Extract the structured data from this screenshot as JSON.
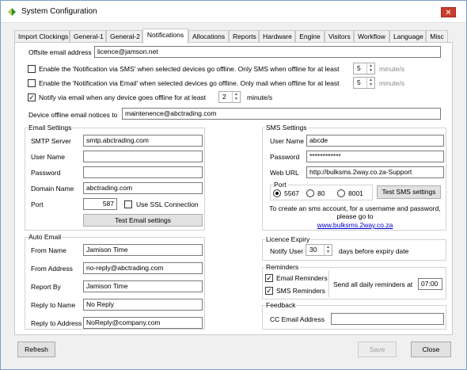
{
  "window": {
    "title": "System Configuration",
    "close_glyph": "✕"
  },
  "tabs": [
    {
      "label": "Import Clockings"
    },
    {
      "label": "General-1"
    },
    {
      "label": "General-2"
    },
    {
      "label": "Notifications"
    },
    {
      "label": "Allocations"
    },
    {
      "label": "Reports"
    },
    {
      "label": "Hardware"
    },
    {
      "label": "Engine"
    },
    {
      "label": "Visitors"
    },
    {
      "label": "Workflow"
    },
    {
      "label": "Language"
    },
    {
      "label": "Misc"
    }
  ],
  "active_tab": "Notifications",
  "offsite": {
    "label": "Offsite email address",
    "value": "licence@jamson.net"
  },
  "notify_sms": {
    "checked": false,
    "label": "Enable the 'Notification via SMS' when selected devices go offline. Only SMS when offline for at least",
    "value": "5",
    "unit": "minute/s"
  },
  "notify_email": {
    "checked": false,
    "label": "Enable the 'Notification via Email' when selected devices go offline. Only mail when offline for at least",
    "value": "5",
    "unit": "minute/s"
  },
  "notify_any": {
    "checked": true,
    "check_glyph": "✓",
    "label": "Notify via email when any device goes offline for at least",
    "value": "2",
    "unit": "minute/s"
  },
  "device_offline": {
    "label": "Device offline email notices to",
    "value": "maintenence@abctrading.com"
  },
  "email_settings": {
    "title": "Email Settings",
    "smtp_label": "SMTP Server",
    "smtp_value": "smtp.abctrading.com",
    "user_label": "User Name",
    "user_value": "",
    "password_label": "Password",
    "password_value": "",
    "domain_label": "Domain Name",
    "domain_value": "abctrading.com",
    "port_label": "Port",
    "port_value": "587",
    "ssl_label": "Use SSL Connection",
    "ssl_checked": false,
    "test_button": "Test Email settings"
  },
  "sms_settings": {
    "title": "SMS Settings",
    "user_label": "User Name",
    "user_value": "abcde",
    "password_label": "Password",
    "password_value": "************",
    "url_label": "Web URL",
    "url_value": "http://bulksms.2way.co.za-Support",
    "port_title": "Port",
    "ports": [
      {
        "label": "5567",
        "selected": true
      },
      {
        "label": "80",
        "selected": false
      },
      {
        "label": "8001",
        "selected": false
      }
    ],
    "test_button": "Test SMS settings",
    "info_text": "To create an sms account, for a username and password, please go to",
    "link_text": "www.bulksms.2way.co.za"
  },
  "auto_email": {
    "title": "Auto Email",
    "from_name_label": "From Name",
    "from_name_value": "Jamison Time",
    "from_address_label": "From Address",
    "from_address_value": "no-reply@abctrading.com",
    "report_by_label": "Report By",
    "report_by_value": "Jamison Time",
    "reply_to_name_label": "Reply to Name",
    "reply_to_name_value": "No Reply",
    "reply_to_address_label": "Reply to Address",
    "reply_to_address_value": "NoReply@company.com"
  },
  "licence_expiry": {
    "title": "Licence Expiry",
    "notify_label": "Notify User",
    "value": "30",
    "suffix": "days before expiry date"
  },
  "reminders": {
    "title": "Reminders",
    "email_label": "Email Reminders",
    "email_checked": true,
    "sms_label": "SMS Reminders",
    "sms_checked": true,
    "send_label": "Send all daily reminders at",
    "time_value": "07:00"
  },
  "feedback": {
    "title": "Feedback",
    "cc_label": "CC Email Address",
    "cc_value": ""
  },
  "footer": {
    "refresh": "Refresh",
    "save": "Save",
    "close": "Close"
  }
}
